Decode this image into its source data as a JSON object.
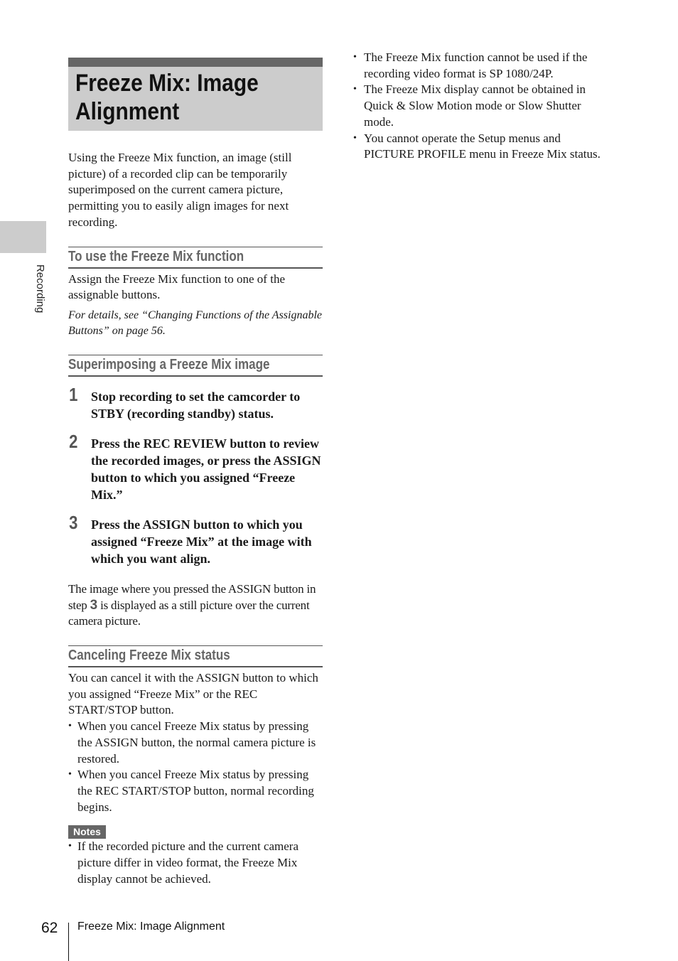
{
  "side_tab": {
    "label": "Recording"
  },
  "title": "Freeze Mix: Image Alignment",
  "intro": "Using the Freeze Mix function, an image (still picture) of a recorded clip can be temporarily superimposed on the current camera picture, permitting you to easily align images for next recording.",
  "section_use": {
    "heading": "To use the Freeze Mix function",
    "body": "Assign the Freeze Mix function to one of the assignable buttons.",
    "reference": "For details, see “Changing Functions of the Assignable Buttons” on page 56."
  },
  "section_superimpose": {
    "heading": "Superimposing a Freeze Mix image",
    "steps": [
      {
        "number": "1",
        "text": "Stop recording to set the camcorder to STBY (recording standby) status."
      },
      {
        "number": "2",
        "text": "Press the REC REVIEW button to review the recorded images, or press the ASSIGN button to which you assigned “Freeze Mix.”"
      },
      {
        "number": "3",
        "text": "Press the ASSIGN button to which you assigned “Freeze Mix” at the image with which you want align."
      }
    ],
    "result_before": "The image where you pressed the ASSIGN button in step ",
    "result_step": "3",
    "result_after": " is displayed as a still picture over the current camera picture."
  },
  "section_cancel": {
    "heading": "Canceling Freeze Mix status",
    "body": "You can cancel it with the ASSIGN button to which you assigned “Freeze Mix” or the REC START/STOP button.",
    "bullets": [
      "When you cancel Freeze Mix status by pressing the ASSIGN button, the normal camera picture is restored.",
      "When you cancel Freeze Mix status by pressing the REC START/STOP button, normal recording begins."
    ]
  },
  "notes": {
    "label": "Notes",
    "items": [
      "If the recorded picture and the current camera picture differ in video format, the Freeze Mix display cannot be achieved.",
      "The Freeze Mix function cannot be used if the recording video format is SP 1080/24P.",
      "The Freeze Mix display cannot be obtained in Quick & Slow Motion mode or Slow Shutter mode.",
      "You cannot operate the Setup menus and PICTURE PROFILE menu in Freeze Mix status."
    ]
  },
  "footer": {
    "page_number": "62",
    "title": "Freeze Mix: Image Alignment"
  }
}
